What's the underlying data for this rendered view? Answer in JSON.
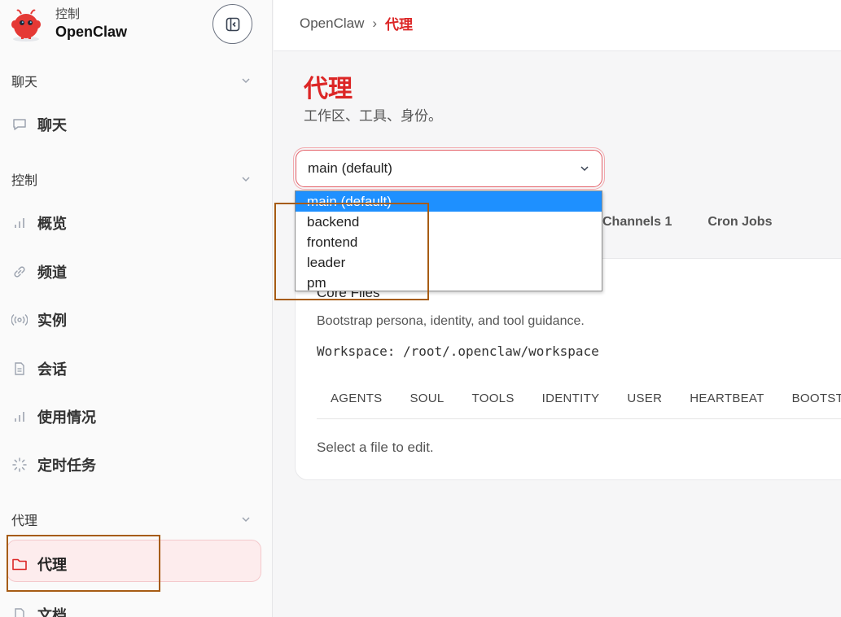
{
  "sidebar": {
    "brand_sub": "控制",
    "brand_name": "OpenClaw",
    "groups": [
      {
        "label": "聊天",
        "items": [
          {
            "label": "聊天",
            "icon": "message-icon"
          }
        ]
      },
      {
        "label": "控制",
        "items": [
          {
            "label": "概览",
            "icon": "bar-chart-icon"
          },
          {
            "label": "频道",
            "icon": "link-icon"
          },
          {
            "label": "实例",
            "icon": "radio-icon"
          },
          {
            "label": "会话",
            "icon": "document-icon"
          },
          {
            "label": "使用情况",
            "icon": "bar-chart-icon"
          },
          {
            "label": "定时任务",
            "icon": "loader-icon"
          }
        ]
      },
      {
        "label": "代理",
        "items": [
          {
            "label": "代理",
            "icon": "folder-icon",
            "active": true
          },
          {
            "label": "文档",
            "icon": "document-icon"
          }
        ]
      }
    ]
  },
  "breadcrumb": {
    "root": "OpenClaw",
    "sep": "›",
    "current": "代理"
  },
  "page": {
    "title": "代理",
    "subtitle": "工作区、工具、身份。"
  },
  "agent_select": {
    "value": "main (default)",
    "options": [
      "main (default)",
      "backend",
      "frontend",
      "leader",
      "pm"
    ]
  },
  "tabs": [
    "Channels 1",
    "Cron Jobs"
  ],
  "card": {
    "title": "Core Files",
    "description": "Bootstrap persona, identity, and tool guidance.",
    "workspace": "Workspace: /root/.openclaw/workspace",
    "file_tabs": [
      "AGENTS",
      "SOUL",
      "TOOLS",
      "IDENTITY",
      "USER",
      "HEARTBEAT",
      "BOOTSTRAP"
    ],
    "empty": "Select a file to edit."
  },
  "colors": {
    "accent": "#dc2626",
    "option_selected": "#1e90ff",
    "highlight": "#a65c14"
  }
}
